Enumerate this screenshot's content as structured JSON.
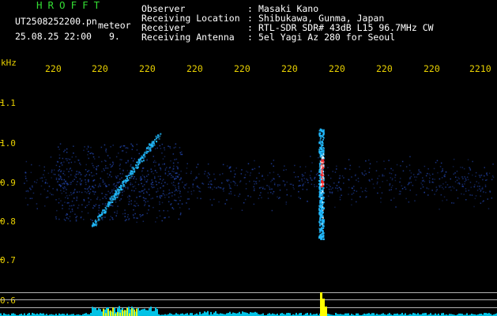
{
  "header": {
    "title": "HROFFT",
    "filename": "UT2508252200.pn",
    "kind": "meteor",
    "datetime": "25.08.25 22:00",
    "count": "9."
  },
  "info": [
    {
      "label": "Observer",
      "sep": ":",
      "value": "Masaki Kano"
    },
    {
      "label": "Receiving Location",
      "sep": ":",
      "value": "Shibukawa, Gunma, Japan"
    },
    {
      "label": "Receiver",
      "sep": ":",
      "value": "RTL-SDR SDR# 43dB L15 96.7MHz CW"
    },
    {
      "label": "Receiving Antenna",
      "sep": ":",
      "value": "5el Yagi Az 280 for Seoul"
    }
  ],
  "axis": {
    "y_unit": "kHz",
    "x_ticks": [
      "220",
      "220",
      "220",
      "220",
      "220",
      "220",
      "220",
      "220",
      "220",
      "2210"
    ],
    "y_ticks": [
      "1.1",
      "1.0",
      "0.9",
      "0.8",
      "0.7",
      "0.6"
    ]
  },
  "colors": {
    "header_title": "#33dd33",
    "text": "#ffffff",
    "ticks": "#e8d000",
    "echo_core": "#ff2020",
    "echo_mid": "#22bbff",
    "noise": "#2244aa",
    "spectrum": "#00d8ff",
    "spectrum_peak": "#ffff00"
  }
}
